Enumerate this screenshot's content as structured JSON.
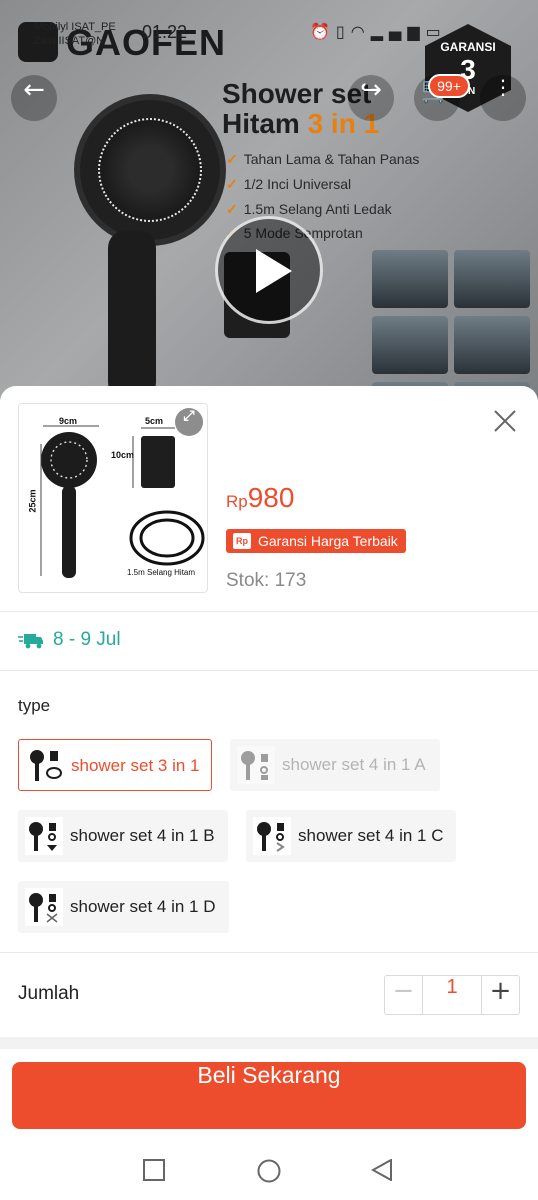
{
  "status_bar": {
    "carrier_line1": "Mobilyl ISAT_PE",
    "carrier_line2": "Zain IISAT@N",
    "time": "01.22",
    "icons": [
      "alarm-icon",
      "vibrate-icon",
      "wifi-icon",
      "signal-icon",
      "battery-icon"
    ]
  },
  "banner": {
    "brand": "GAOFEN",
    "title_line1": "Shower set",
    "title_line2_prefix": "Hitam ",
    "title_line2_accent": "3 in 1",
    "features": [
      "Tahan Lama & Tahan Panas",
      "1/2 Inci Universal",
      "1.5m Selang Anti Ledak",
      "5 Mode Semprotan"
    ],
    "badge_line1": "GARANSI",
    "badge_number": "3",
    "badge_line3": "UN",
    "accent_color": "#e8800f"
  },
  "top_nav": {
    "back_icon": "back-arrow-icon",
    "share_icon": "share-icon",
    "cart_icon": "cart-icon",
    "cart_badge": "99+",
    "more_icon": "more-vertical-icon"
  },
  "sheet": {
    "thumbnail_labels": {
      "width": "9cm",
      "bracket_width": "5cm",
      "bracket_height": "10cm",
      "height": "25cm",
      "hose": "1.5m Selang Hitam"
    },
    "price_currency": "Rp",
    "price_value": "980",
    "guarantee_icon_text": "Rp",
    "guarantee_label": "Garansi Harga Terbaik",
    "stock": "Stok: 173",
    "shipping_dates": "8 - 9 Jul",
    "variant_section_label": "type",
    "variants": [
      {
        "label": "shower set 3 in 1",
        "state": "selected"
      },
      {
        "label": "shower set 4 in 1 A",
        "state": "disabled"
      },
      {
        "label": "shower set 4 in 1 B",
        "state": "normal"
      },
      {
        "label": "shower set 4 in 1 C",
        "state": "normal"
      },
      {
        "label": "shower set 4 in 1 D",
        "state": "normal"
      }
    ],
    "quantity_label": "Jumlah",
    "quantity_value": "1",
    "decrement": "−",
    "increment": "+",
    "buy_button": "Beli Sekarang",
    "brand_color": "#ee4d2d",
    "shipping_color": "#26aa99"
  },
  "system_nav": {
    "recent": "square-icon",
    "home": "circle-icon",
    "back": "triangle-back-icon"
  }
}
